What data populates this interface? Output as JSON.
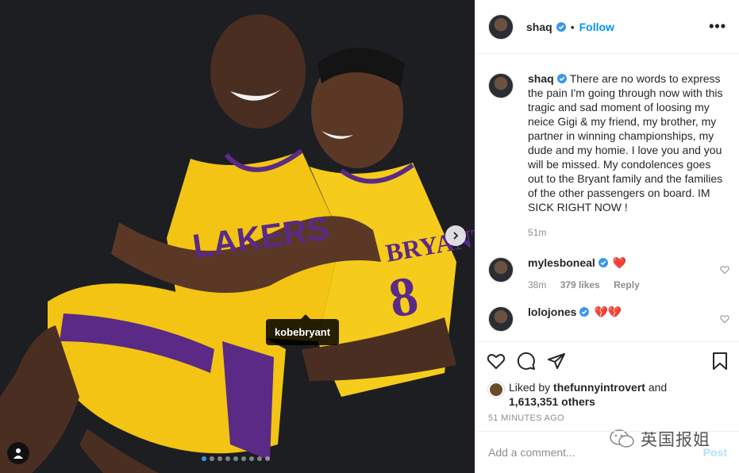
{
  "post": {
    "photo_tag": "kobebryant",
    "slide_count": 9,
    "active_slide": 1
  },
  "header": {
    "username": "shaq",
    "follow_label": "Follow",
    "separator": "•",
    "more_label": "•••"
  },
  "caption": {
    "username": "shaq",
    "text": "There are no words to express the pain I'm going through now with this tragic and sad moment of loosing my neice Gigi & my friend, my brother, my partner in winning championships, my dude and my homie. I love you and you will be missed. My condolences goes out to the Bryant family and the families of the other passengers on board. IM SICK RIGHT NOW !",
    "time": "51m"
  },
  "comments": [
    {
      "username": "mylesboneal",
      "text": "❤️",
      "time": "38m",
      "likes": "379 likes",
      "reply_label": "Reply"
    },
    {
      "username": "lolojones",
      "text": "💔💔"
    }
  ],
  "likes": {
    "prefix": "Liked by",
    "first_user": "thefunnyintrovert",
    "joiner": "and",
    "others": "1,613,351 others"
  },
  "timestamp": "51 MINUTES AGO",
  "composer": {
    "placeholder": "Add a comment...",
    "post_label": "Post"
  },
  "watermark": "英国报姐",
  "colors": {
    "accent": "#0095f6",
    "verified": "#3897f0",
    "heart": "#ed4956",
    "lakers_gold": "#f5c518",
    "lakers_purple": "#552583"
  }
}
